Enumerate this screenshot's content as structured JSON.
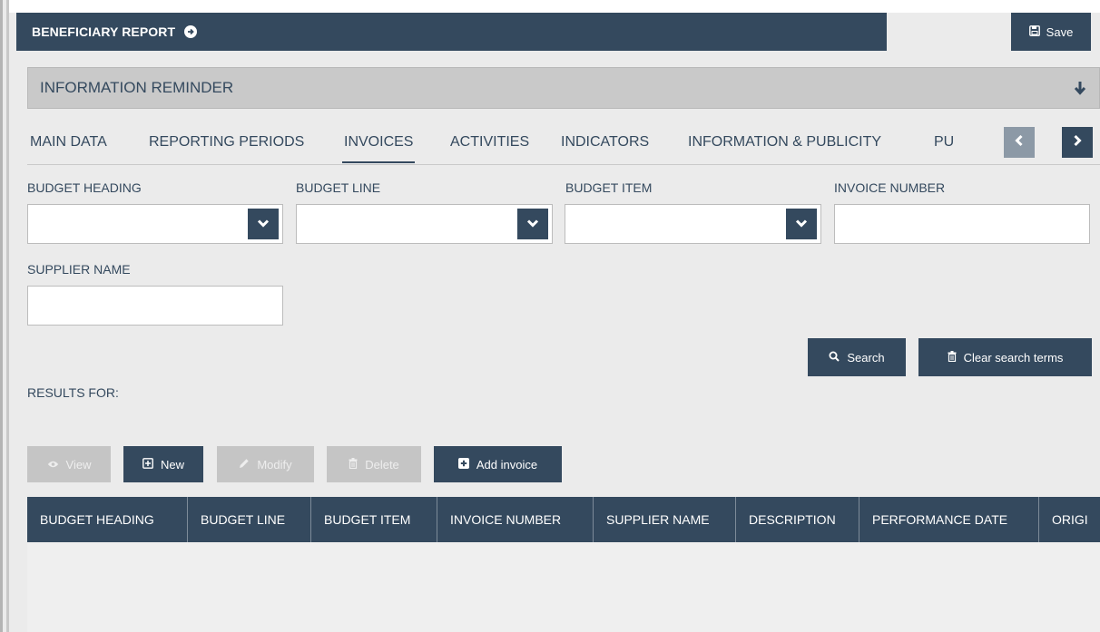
{
  "header": {
    "title": "BENEFICIARY REPORT",
    "save_label": "Save"
  },
  "reminder": {
    "title": "INFORMATION REMINDER"
  },
  "tabs": [
    {
      "label": "MAIN DATA"
    },
    {
      "label": "REPORTING PERIODS"
    },
    {
      "label": "INVOICES"
    },
    {
      "label": "ACTIVITIES"
    },
    {
      "label": "INDICATORS"
    },
    {
      "label": "INFORMATION & PUBLICITY"
    },
    {
      "label": "PU"
    }
  ],
  "active_tab": "INVOICES",
  "filters": {
    "budget_heading": {
      "label": "BUDGET HEADING",
      "value": ""
    },
    "budget_line": {
      "label": "BUDGET LINE",
      "value": ""
    },
    "budget_item": {
      "label": "BUDGET ITEM",
      "value": ""
    },
    "invoice_number": {
      "label": "INVOICE NUMBER",
      "value": ""
    },
    "supplier_name": {
      "label": "SUPPLIER NAME",
      "value": ""
    }
  },
  "search": {
    "search_label": "Search",
    "clear_label": "Clear search terms"
  },
  "results_label": "RESULTS FOR:",
  "toolbar": {
    "view_label": "View",
    "new_label": "New",
    "modify_label": "Modify",
    "delete_label": "Delete",
    "add_invoice_label": "Add invoice"
  },
  "table": {
    "columns": [
      "BUDGET HEADING",
      "BUDGET LINE",
      "BUDGET ITEM",
      "INVOICE NUMBER",
      "SUPPLIER NAME",
      "DESCRIPTION",
      "PERFORMANCE DATE",
      "ORIGI"
    ],
    "rows": []
  },
  "colors": {
    "primary": "#34495e",
    "disabled": "#c5c5c5",
    "background": "#ebebeb"
  },
  "icons": {
    "header_arrow": "arrow-circle-right-icon",
    "save": "floppy-disk-icon",
    "reminder_toggle": "arrow-down-icon",
    "tab_prev": "chevron-left-icon",
    "tab_next": "chevron-right-icon",
    "select_caret": "chevron-down-icon",
    "search": "search-icon",
    "clear": "trash-icon",
    "view": "eye-icon",
    "new": "plus-square-icon",
    "modify": "pencil-icon",
    "delete": "trash-icon",
    "add_invoice": "plus-square-solid-icon"
  }
}
